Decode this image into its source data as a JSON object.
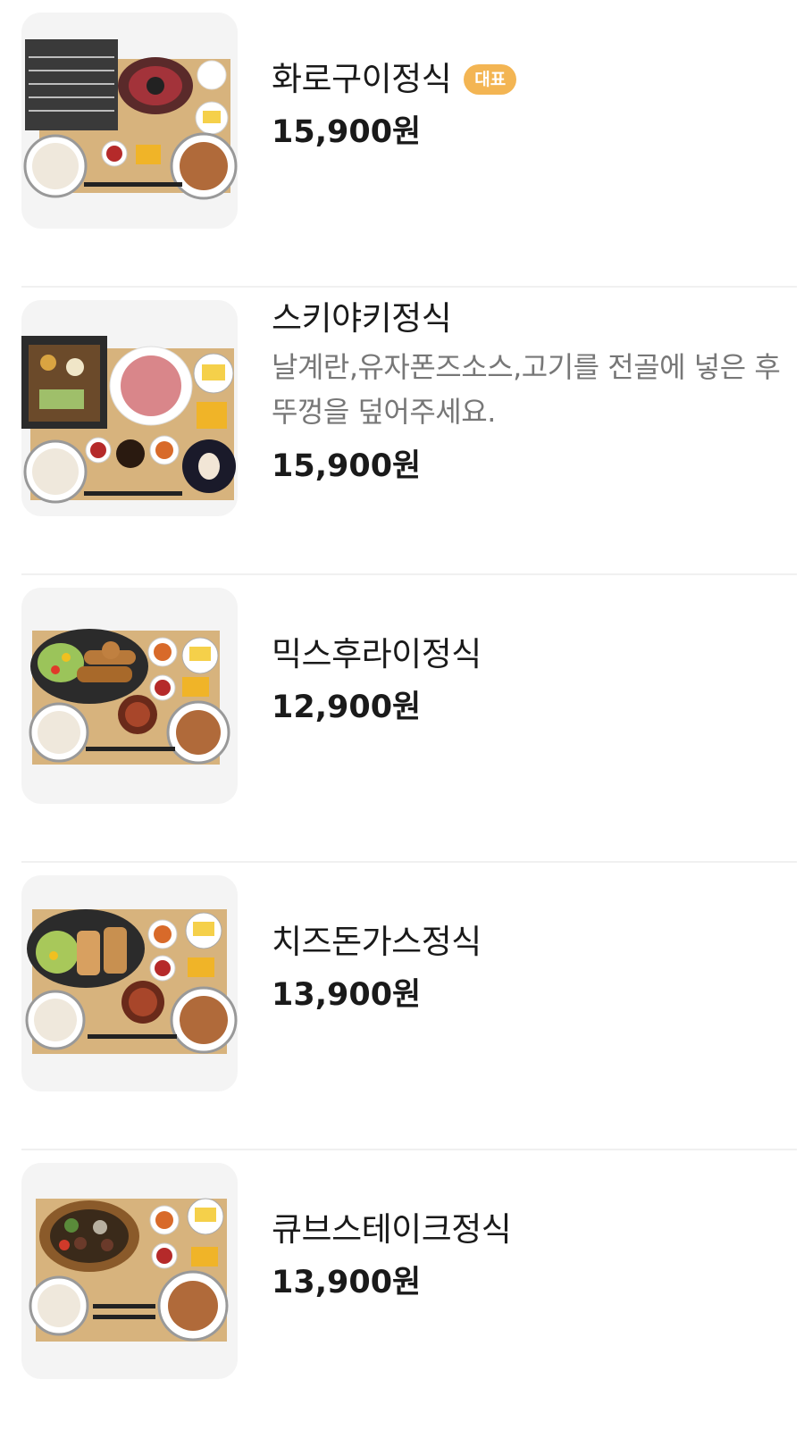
{
  "menu": {
    "items": [
      {
        "name": "화로구이정식",
        "badge": "대표",
        "price": "15,900원"
      },
      {
        "name": "스키야키정식",
        "description": "날계란,유자폰즈소스,고기를 전골에 넣은 후 뚜껑을 덮어주세요.",
        "price": "15,900원"
      },
      {
        "name": "믹스후라이정식",
        "price": "12,900원"
      },
      {
        "name": "치즈돈가스정식",
        "price": "13,900원"
      },
      {
        "name": "큐브스테이크정식",
        "price": "13,900원"
      }
    ]
  },
  "colors": {
    "badge": "#f3b553",
    "price": "#1a1a1a",
    "description": "#777777",
    "divider": "#f0f0f0",
    "thumb_bg": "#f4f4f4",
    "tray": "#d7b37d"
  },
  "icons": [
    "food-photo-grill-set",
    "food-photo-sukiyaki-set",
    "food-photo-mix-fry-set",
    "food-photo-cheese-cutlet-set",
    "food-photo-cube-steak-set"
  ]
}
